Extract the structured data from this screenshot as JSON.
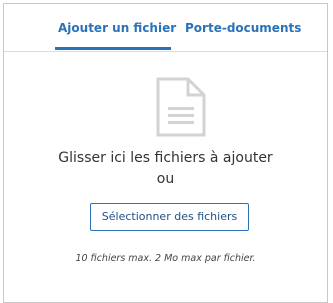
{
  "tabs": {
    "add_file": "Ajouter un fichier",
    "briefcase": "Porte-documents",
    "active": "add_file"
  },
  "dropzone": {
    "icon": "document-icon",
    "line1": "Glisser ici les fichiers à ajouter",
    "line2": "ou",
    "button_label": "Sélectionner des fichiers",
    "limits": "10 fichiers max. 2 Mo max par fichier."
  },
  "colors": {
    "accent": "#2b72b8",
    "icon": "#d3d3d3",
    "border": "#c8c8c8"
  }
}
